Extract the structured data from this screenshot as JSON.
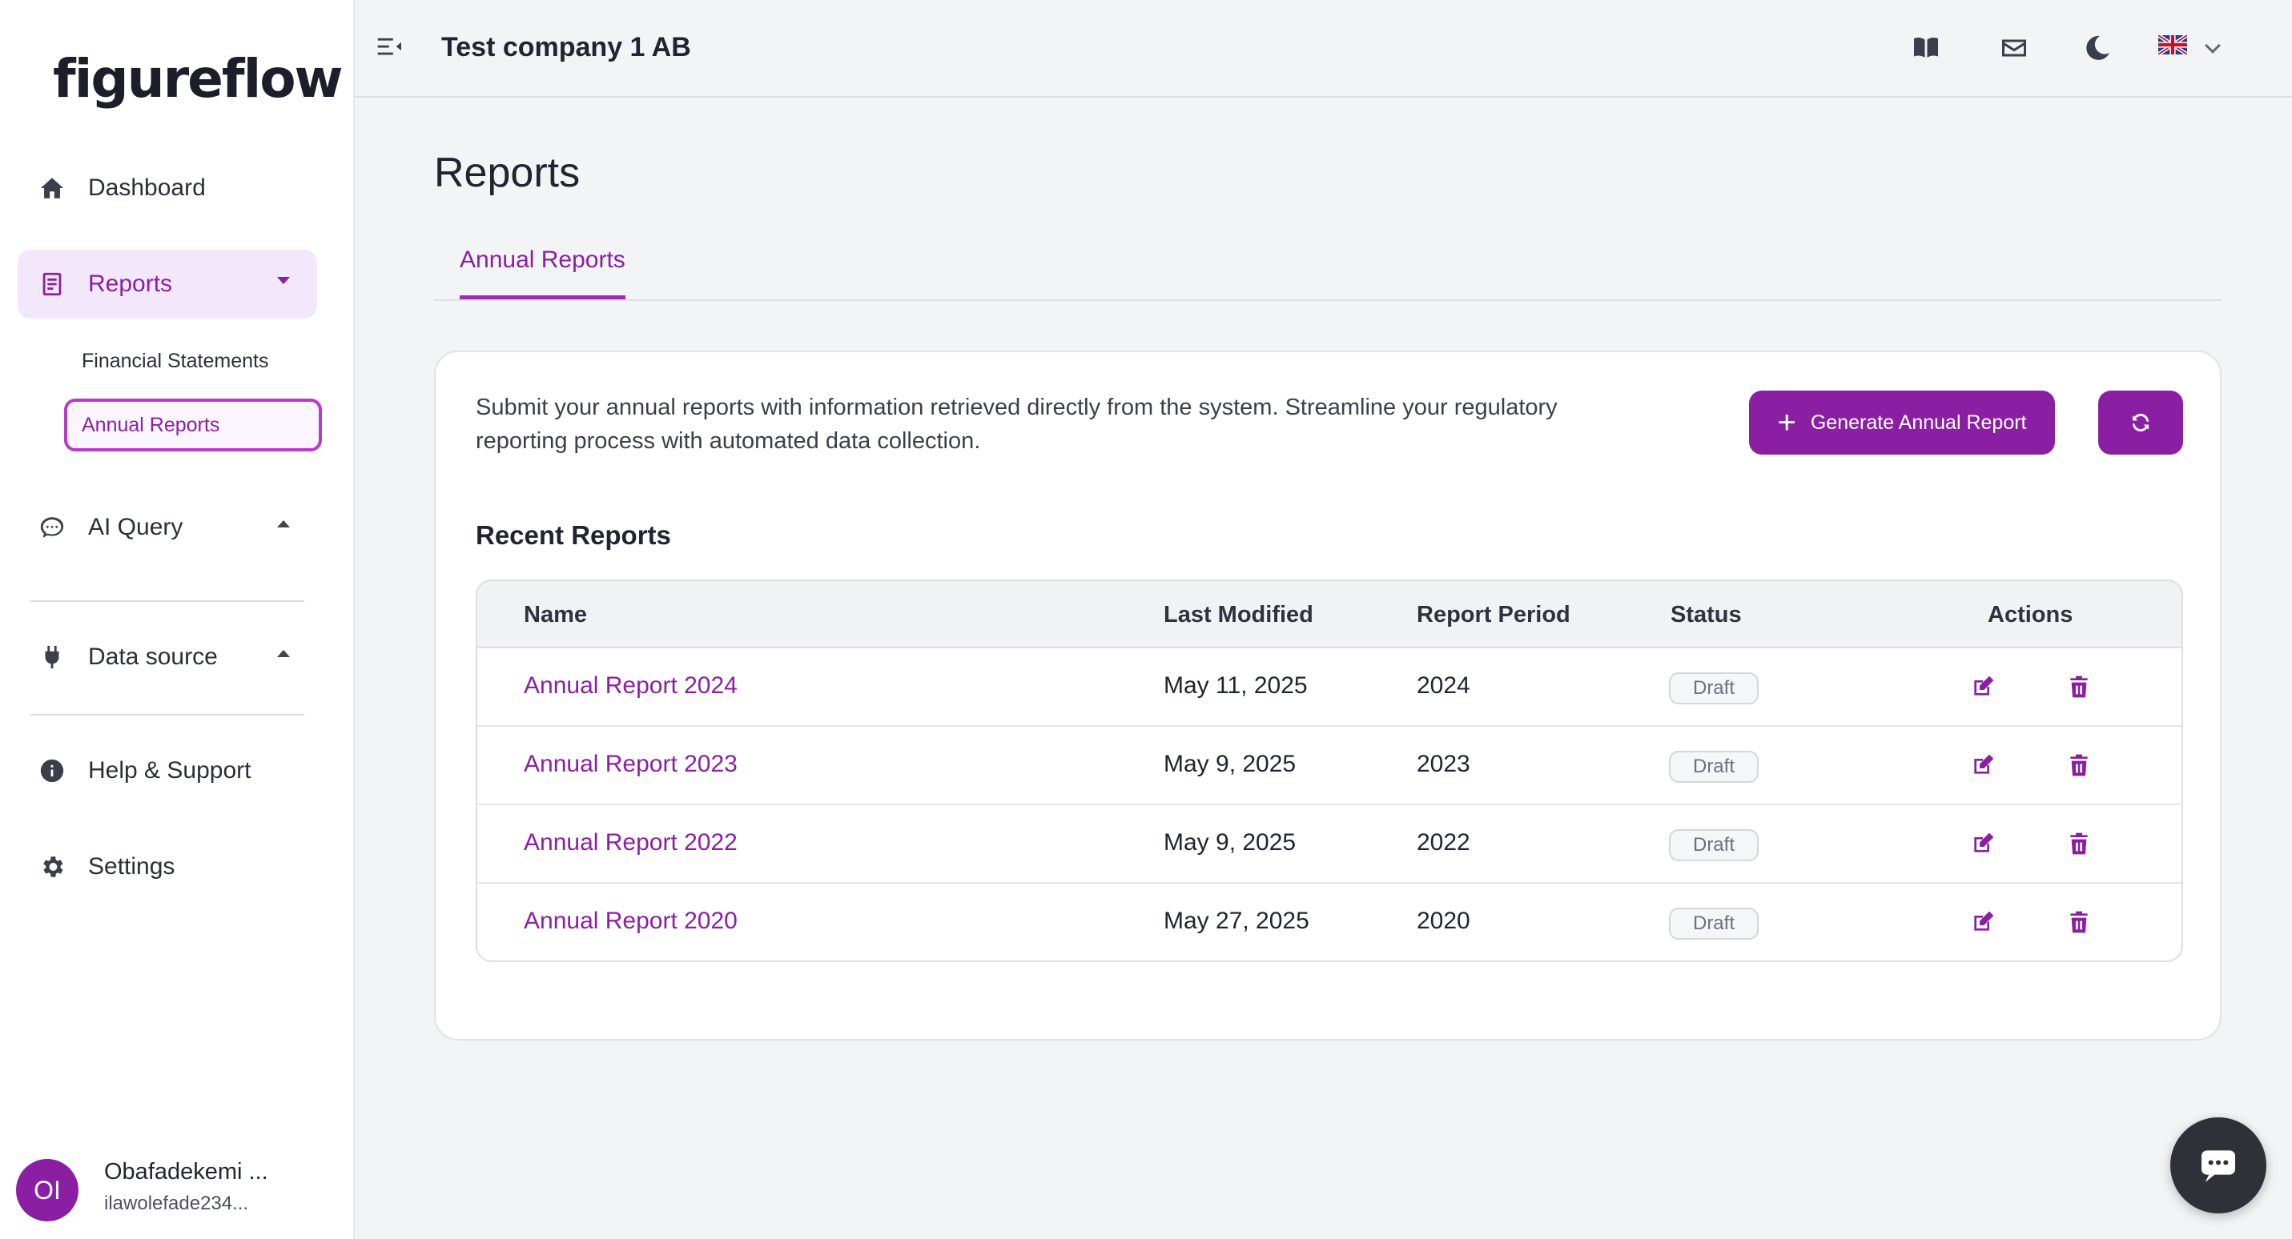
{
  "app": {
    "logo": "figureflow",
    "company": "Test company 1 AB"
  },
  "sidebar": {
    "items": [
      {
        "label": "Dashboard",
        "icon": "home-icon"
      },
      {
        "label": "Reports",
        "icon": "document-icon",
        "active": true
      },
      {
        "label": "AI Query",
        "icon": "chat-bubble-icon"
      },
      {
        "label": "Data source",
        "icon": "plug-icon"
      },
      {
        "label": "Help & Support",
        "icon": "info-icon"
      },
      {
        "label": "Settings",
        "icon": "gear-icon"
      }
    ],
    "sub_items": [
      {
        "label": "Financial Statements"
      },
      {
        "label": "Annual Reports",
        "active": true
      }
    ]
  },
  "user": {
    "initials": "OI",
    "name": "Obafadekemi ...",
    "email": "ilawolefade234..."
  },
  "page": {
    "title": "Reports",
    "tab": "Annual Reports",
    "description": "Submit your annual reports with information retrieved directly from the system. Streamline your regulatory reporting process with automated data collection.",
    "generate_label": "Generate Annual Report",
    "section_title": "Recent Reports"
  },
  "table": {
    "headers": {
      "name": "Name",
      "modified": "Last Modified",
      "period": "Report Period",
      "status": "Status",
      "actions": "Actions"
    },
    "rows": [
      {
        "name": "Annual Report 2024",
        "modified": "May 11, 2025",
        "period": "2024",
        "status": "Draft"
      },
      {
        "name": "Annual Report 2023",
        "modified": "May 9, 2025",
        "period": "2023",
        "status": "Draft"
      },
      {
        "name": "Annual Report 2022",
        "modified": "May 9, 2025",
        "period": "2022",
        "status": "Draft"
      },
      {
        "name": "Annual Report 2020",
        "modified": "May 27, 2025",
        "period": "2020",
        "status": "Draft"
      }
    ]
  },
  "colors": {
    "accent": "#8b1fa3",
    "accent_light": "#f3e8fb",
    "background": "#f3f4f6"
  }
}
